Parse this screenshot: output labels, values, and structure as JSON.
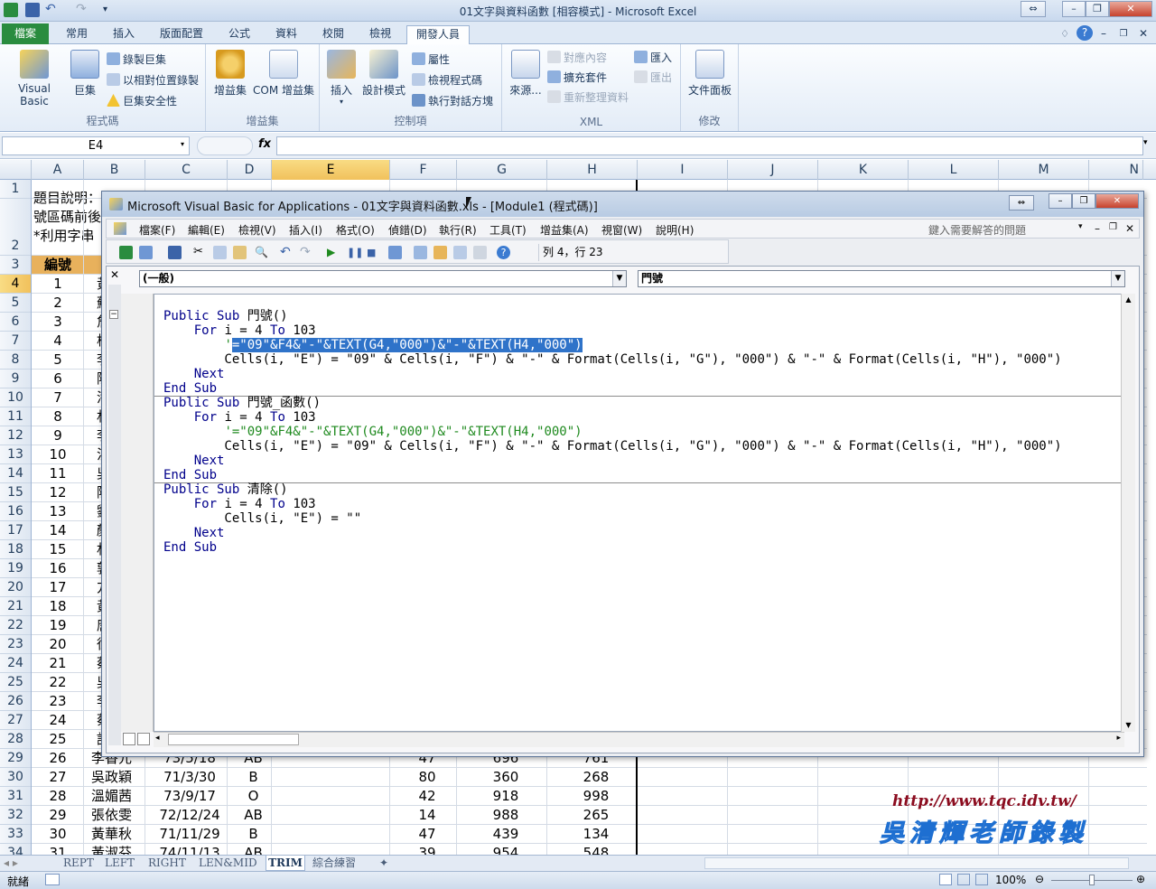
{
  "window": {
    "title": "01文字與資料函數 [相容模式] - Microsoft Excel"
  },
  "tabs": [
    "檔案",
    "常用",
    "插入",
    "版面配置",
    "公式",
    "資料",
    "校閱",
    "檢視",
    "開發人員"
  ],
  "ribbon": {
    "groups": {
      "code": "程式碼",
      "addins": "增益集",
      "controls": "控制項",
      "xml": "XML",
      "modify": "修改"
    },
    "visual_basic": "Visual Basic",
    "macros": "巨集",
    "record_macro": "錄製巨集",
    "relative_ref": "以相對位置錄製",
    "macro_security": "巨集安全性",
    "addins": "增益集",
    "com_addins": "COM 增益集",
    "insert": "插入",
    "design_mode": "設計模式",
    "properties": "屬性",
    "view_code": "檢視程式碼",
    "run_dialog": "執行對話方塊",
    "source": "來源...",
    "map_props": "對應內容",
    "expansion": "擴充套件",
    "refresh_data": "重新整理資料",
    "import": "匯入",
    "export": "匯出",
    "doc_panel": "文件面板"
  },
  "formula_bar": {
    "name_box": "E4",
    "fx": "fx",
    "value": ""
  },
  "columns": [
    "A",
    "B",
    "C",
    "D",
    "E",
    "F",
    "G",
    "H",
    "I",
    "J",
    "K",
    "L",
    "M",
    "N"
  ],
  "rows": [
    "1",
    "2",
    "3",
    "4",
    "5",
    "6",
    "7",
    "8",
    "9",
    "10",
    "11",
    "12",
    "13",
    "14",
    "15",
    "16",
    "17",
    "18",
    "19",
    "20",
    "21",
    "22",
    "23",
    "24",
    "25",
    "26",
    "27",
    "28",
    "29",
    "30",
    "31",
    "32",
    "33",
    "34"
  ],
  "sheet": {
    "desc1": "題目說明：",
    "desc2": "號區碼前後",
    "desc3": "*利用字串",
    "hdr_a": "編號",
    "ids": [
      "1",
      "2",
      "3",
      "4",
      "5",
      "6",
      "7",
      "8",
      "9",
      "10",
      "11",
      "12",
      "13",
      "14",
      "15",
      "16",
      "17",
      "18",
      "19",
      "20",
      "21",
      "22",
      "23",
      "24",
      "25",
      "26",
      "27",
      "28",
      "29",
      "30",
      "31"
    ],
    "bcol_partial": [
      "黃",
      "蘇",
      "詹",
      "楊",
      "李",
      "陳",
      "潘",
      "林",
      "李",
      "洪",
      "吳",
      "陳",
      "劉",
      "顏",
      "林",
      "郭",
      "方",
      "黃",
      "唐",
      "徐",
      "蔡",
      "吳",
      "李",
      "蔡",
      "許"
    ],
    "data_rows": [
      {
        "a": "26",
        "b": "李香元",
        "c": "73/5/18",
        "d": "AB",
        "f": "47",
        "g": "696",
        "h": "761"
      },
      {
        "a": "27",
        "b": "吳政穎",
        "c": "71/3/30",
        "d": "B",
        "f": "80",
        "g": "360",
        "h": "268"
      },
      {
        "a": "28",
        "b": "溫媚茜",
        "c": "73/9/17",
        "d": "O",
        "f": "42",
        "g": "918",
        "h": "998"
      },
      {
        "a": "29",
        "b": "張依雯",
        "c": "72/12/24",
        "d": "AB",
        "f": "14",
        "g": "988",
        "h": "265"
      },
      {
        "a": "30",
        "b": "黃華秋",
        "c": "71/11/29",
        "d": "B",
        "f": "47",
        "g": "439",
        "h": "134"
      },
      {
        "a": "31",
        "b": "黃淑芬",
        "c": "74/11/13",
        "d": "AB",
        "f": "39",
        "g": "954",
        "h": "548"
      }
    ]
  },
  "sheet_tabs": [
    "REPT",
    "LEFT",
    "RIGHT",
    "LEN&MID",
    "TRIM",
    "綜合練習"
  ],
  "active_sheet": "TRIM",
  "status": {
    "ready": "就緒",
    "zoom": "100%"
  },
  "vba": {
    "title": "Microsoft Visual Basic for Applications - 01文字與資料函數.xls - [Module1 (程式碼)]",
    "menu": [
      "檔案(F)",
      "編輯(E)",
      "檢視(V)",
      "插入(I)",
      "格式(O)",
      "偵錯(D)",
      "執行(R)",
      "工具(T)",
      "增益集(A)",
      "視窗(W)",
      "說明(H)"
    ],
    "help_placeholder": "鍵入需要解答的問題",
    "position": "列 4，行 23",
    "object_combo": "(一般)",
    "proc_combo": "門號",
    "code": [
      {
        "parts": [
          [
            "kw",
            "Public Sub "
          ],
          [
            "n",
            "門號()"
          ]
        ]
      },
      {
        "parts": [
          [
            "n",
            "    "
          ],
          [
            "kw",
            "For"
          ],
          [
            "n",
            " i = 4 "
          ],
          [
            "kw",
            "To"
          ],
          [
            "n",
            " 103"
          ]
        ]
      },
      {
        "parts": [
          [
            "n",
            "        "
          ],
          [
            "cm",
            "'"
          ],
          [
            "hl",
            "=\"09\"&F4&\"-\"&TEXT(G4,\"000\")&\"-\"&TEXT(H4,\"000\")"
          ]
        ]
      },
      {
        "parts": [
          [
            "n",
            "        Cells(i, \"E\") = \"09\" & Cells(i, \"F\") & \"-\" & Format(Cells(i, \"G\"), \"000\") & \"-\" & Format(Cells(i, \"H\"), \"000\")"
          ]
        ]
      },
      {
        "parts": [
          [
            "n",
            "    "
          ],
          [
            "kw",
            "Next"
          ]
        ]
      },
      {
        "parts": [
          [
            "kw",
            "End Sub"
          ]
        ]
      },
      {
        "parts": [
          [
            "kw",
            "Public Sub "
          ],
          [
            "n",
            "門號_函數()"
          ]
        ]
      },
      {
        "parts": [
          [
            "n",
            "    "
          ],
          [
            "kw",
            "For"
          ],
          [
            "n",
            " i = 4 "
          ],
          [
            "kw",
            "To"
          ],
          [
            "n",
            " 103"
          ]
        ]
      },
      {
        "parts": [
          [
            "n",
            "        "
          ],
          [
            "cm",
            "'=\"09\"&F4&\"-\"&TEXT(G4,\"000\")&\"-\"&TEXT(H4,\"000\")"
          ]
        ]
      },
      {
        "parts": [
          [
            "n",
            "        Cells(i, \"E\") = \"09\" & Cells(i, \"F\") & \"-\" & Format(Cells(i, \"G\"), \"000\") & \"-\" & Format(Cells(i, \"H\"), \"000\")"
          ]
        ]
      },
      {
        "parts": [
          [
            "n",
            "    "
          ],
          [
            "kw",
            "Next"
          ]
        ]
      },
      {
        "parts": [
          [
            "kw",
            "End Sub"
          ]
        ]
      },
      {
        "parts": [
          [
            "kw",
            "Public Sub "
          ],
          [
            "n",
            "清除()"
          ]
        ]
      },
      {
        "parts": [
          [
            "n",
            "    "
          ],
          [
            "kw",
            "For"
          ],
          [
            "n",
            " i = 4 "
          ],
          [
            "kw",
            "To"
          ],
          [
            "n",
            " 103"
          ]
        ]
      },
      {
        "parts": [
          [
            "n",
            "        Cells(i, \"E\") = \"\""
          ]
        ]
      },
      {
        "parts": [
          [
            "n",
            "    "
          ],
          [
            "kw",
            "Next"
          ]
        ]
      },
      {
        "parts": [
          [
            "kw",
            "End Sub"
          ]
        ]
      }
    ]
  },
  "watermark": {
    "url": "http://www.tqc.idv.tw/",
    "author": "吳清輝老師錄製"
  },
  "colors": {
    "excel_green": "#2a8c3f",
    "selection": "#2f73c9",
    "keyword": "#00008b",
    "comment": "#1f8a1f"
  }
}
